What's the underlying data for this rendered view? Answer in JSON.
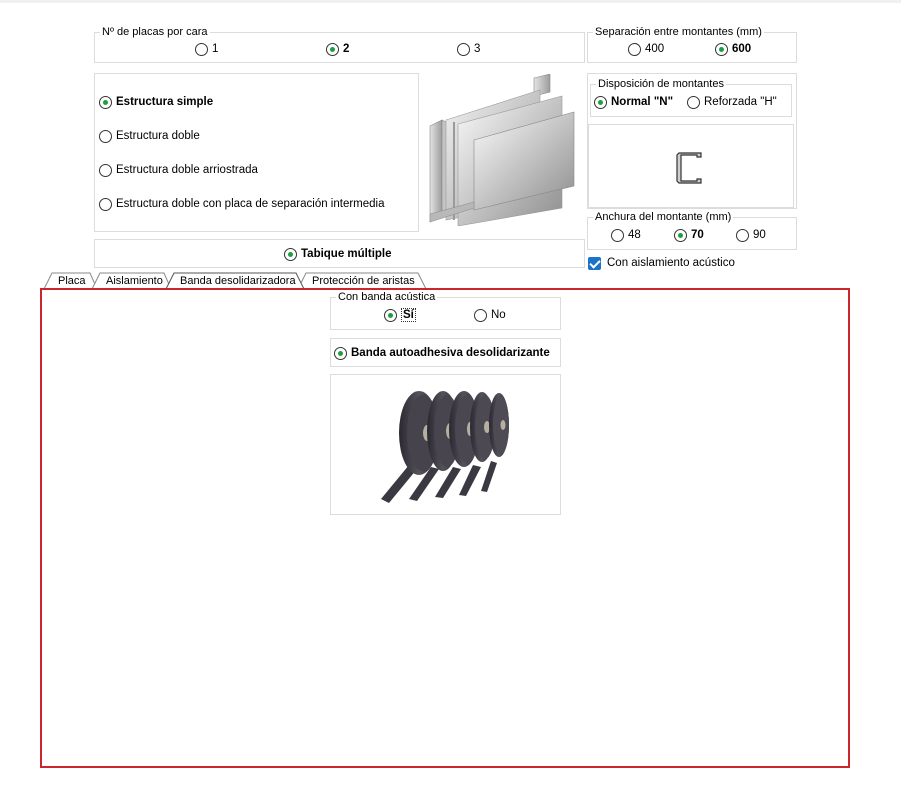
{
  "placas": {
    "legend": "Nº de placas por cara",
    "options": [
      {
        "label": "1",
        "selected": false
      },
      {
        "label": "2",
        "selected": true
      },
      {
        "label": "3",
        "selected": false
      }
    ]
  },
  "separacion": {
    "legend": "Separación entre montantes (mm)",
    "options": [
      {
        "label": "400",
        "selected": false
      },
      {
        "label": "600",
        "selected": true
      }
    ]
  },
  "estructura": {
    "options": [
      {
        "label": "Estructura simple",
        "selected": true
      },
      {
        "label": "Estructura doble",
        "selected": false
      },
      {
        "label": "Estructura doble arriostrada",
        "selected": false
      },
      {
        "label": "Estructura doble con placa de separación intermedia",
        "selected": false
      }
    ]
  },
  "disposicion": {
    "legend": "Disposición de montantes",
    "options": [
      {
        "label": "Normal \"N\"",
        "selected": true
      },
      {
        "label": "Reforzada \"H\"",
        "selected": false
      }
    ]
  },
  "tabique": {
    "label": "Tabique múltiple",
    "selected": true
  },
  "anchura": {
    "legend": "Anchura del montante (mm)",
    "options": [
      {
        "label": "48",
        "selected": false
      },
      {
        "label": "70",
        "selected": true
      },
      {
        "label": "90",
        "selected": false
      }
    ]
  },
  "aislamiento_acustico": {
    "label": "Con aislamiento acústico",
    "checked": true
  },
  "tabs": [
    {
      "label": "Placa",
      "active": false
    },
    {
      "label": "Aislamiento",
      "active": false
    },
    {
      "label": "Banda desolidarizadora",
      "active": true
    },
    {
      "label": "Protección de aristas",
      "active": false
    }
  ],
  "banda": {
    "legend": "Con banda acústica",
    "options": [
      {
        "label": "Sí",
        "selected": true
      },
      {
        "label": "No",
        "selected": false
      }
    ],
    "tipo": {
      "label": "Banda autoadhesiva desolidarizante",
      "selected": true
    }
  },
  "colors": {
    "accent_green": "#1e9e3e",
    "frame_red": "#c9262f",
    "check_blue": "#1a73c8"
  }
}
